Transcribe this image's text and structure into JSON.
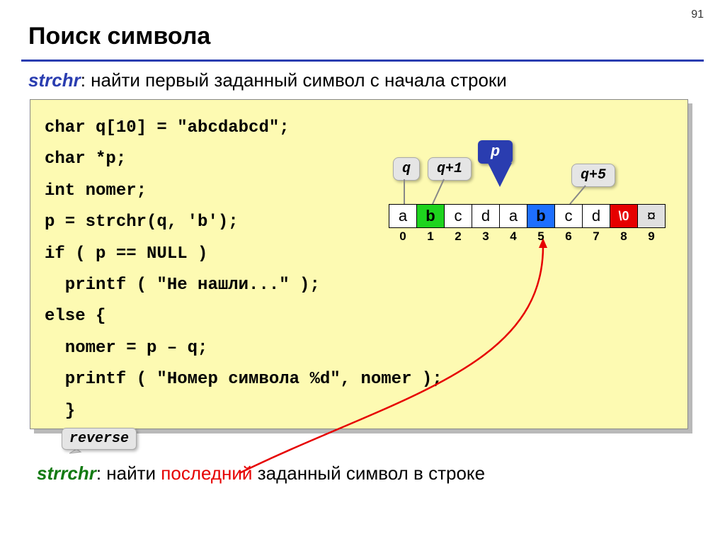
{
  "page_number": "91",
  "title": "Поиск символа",
  "intro": {
    "fn": "strchr",
    "text": ": найти первый заданный символ c начала строки"
  },
  "code": "char q[10] = \"abcdabcd\";\nchar *p;\nint nomer;\np = strchr(q, 'b');\nif ( p == NULL )\n  printf ( \"Не нашли...\" );\nelse {\n  nomer = p – q;\n  printf ( \"Номер символа %d\", nomer );\n  }",
  "labels": {
    "q": "q",
    "q1": "q+1",
    "p": "p",
    "q5": "q+5",
    "reverse": "reverse"
  },
  "cells": [
    {
      "v": "a",
      "cls": ""
    },
    {
      "v": "b",
      "cls": "green"
    },
    {
      "v": "c",
      "cls": ""
    },
    {
      "v": "d",
      "cls": ""
    },
    {
      "v": "a",
      "cls": ""
    },
    {
      "v": "b",
      "cls": "blue"
    },
    {
      "v": "c",
      "cls": ""
    },
    {
      "v": "d",
      "cls": ""
    },
    {
      "v": "\\0",
      "cls": "red"
    },
    {
      "v": "¤",
      "cls": "gray"
    }
  ],
  "indices": [
    "0",
    "1",
    "2",
    "3",
    "4",
    "5",
    "6",
    "7",
    "8",
    "9"
  ],
  "bottom": {
    "fn": "strrchr",
    "pre": ": найти ",
    "last": "последний",
    "post": " заданный символ в строке"
  }
}
